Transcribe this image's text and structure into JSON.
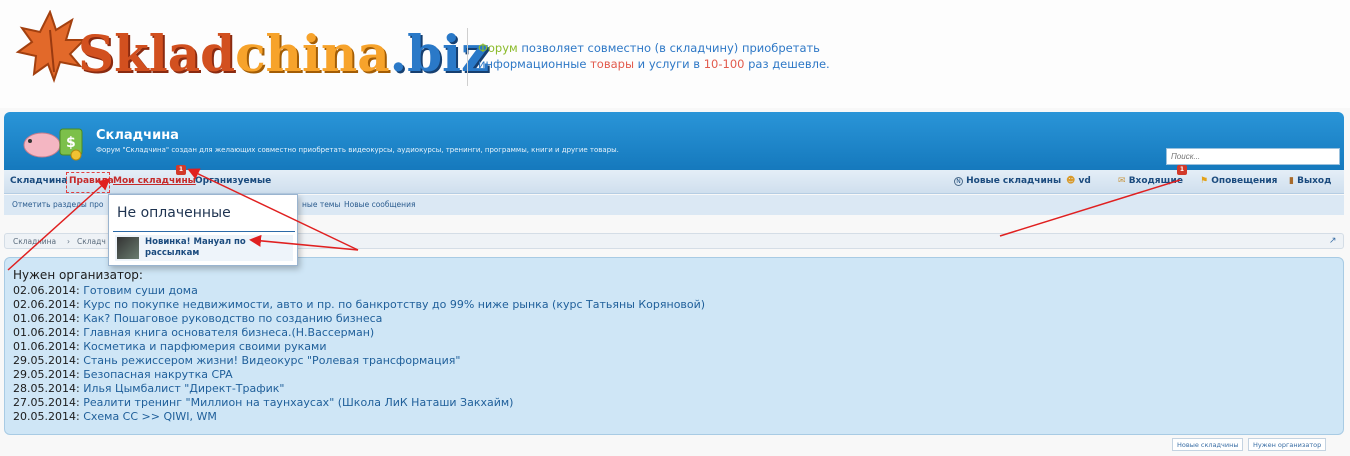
{
  "logo": {
    "part1": "Sklad",
    "part2": "china",
    "part3": ".biz"
  },
  "slogan": {
    "w1": "Форум",
    "w2": " позволяет совместно (в складчину) приобретать",
    "w3": "информационные ",
    "w4": "товары",
    "w5": " и услуги в ",
    "w6": "10-100",
    "w7": " раз дешевле."
  },
  "banner": {
    "title": "Складчина",
    "description": "Форум \"Складчина\" создан для желающих совместно приобретать видеокурсы, аудиокурсы, тренинги, программы, книги и другие товары."
  },
  "search": {
    "placeholder": "Поиск..."
  },
  "nav": {
    "items": [
      "Складчина",
      "Правила",
      "Мои складчины",
      "Организуемые"
    ],
    "badge": "1",
    "right": {
      "new_skladchiny": "Новые складчины",
      "user": "vd",
      "inbox": "Входящие",
      "inbox_badge": "1",
      "alerts": "Оповещения",
      "logout": "Выход"
    }
  },
  "subnav": {
    "mark_read": "Отметить разделы про",
    "new_topics": "ные темы",
    "new_posts": "Новые сообщения"
  },
  "breadcrumb": [
    "Складчина",
    "Складч"
  ],
  "dropdown": {
    "title": "Не оплаченные",
    "item": "Новинка! Мануал по рассылкам"
  },
  "main": {
    "heading": "Нужен организатор:",
    "rows": [
      {
        "date": "02.06.2014",
        "title": "Готовим суши дома"
      },
      {
        "date": "02.06.2014",
        "title": "Курс по покупке недвижимости, авто и пр. по банкротству до 99% ниже рынка (курс Татьяны Коряновой)"
      },
      {
        "date": "01.06.2014",
        "title": "Как? Пошаговое руководство по созданию бизнеса"
      },
      {
        "date": "01.06.2014",
        "title": "Главная книга основателя бизнеса.(Н.Вассерман)"
      },
      {
        "date": "01.06.2014",
        "title": "Косметика и парфюмерия своими руками"
      },
      {
        "date": "29.05.2014",
        "title": "Стань режиссером жизни! Видеокурс \"Ролевая трансформация\""
      },
      {
        "date": "29.05.2014",
        "title": "Безопасная накрутка CPA"
      },
      {
        "date": "28.05.2014",
        "title": "Илья Цымбалист \"Директ-Трафик\""
      },
      {
        "date": "27.05.2014",
        "title": "Реалити тренинг \"Миллион на таунхаусах\" (Школа ЛиК Наташи Закхайм)"
      },
      {
        "date": "20.05.2014",
        "title": "Схема СС >> QIWI, WM"
      }
    ]
  },
  "footer_tabs": [
    "Новые складчины",
    "Нужен организатор"
  ],
  "colors": {
    "banner": "#1a85c9",
    "accent_red": "#d23a2a",
    "link": "#1f5f9a"
  }
}
